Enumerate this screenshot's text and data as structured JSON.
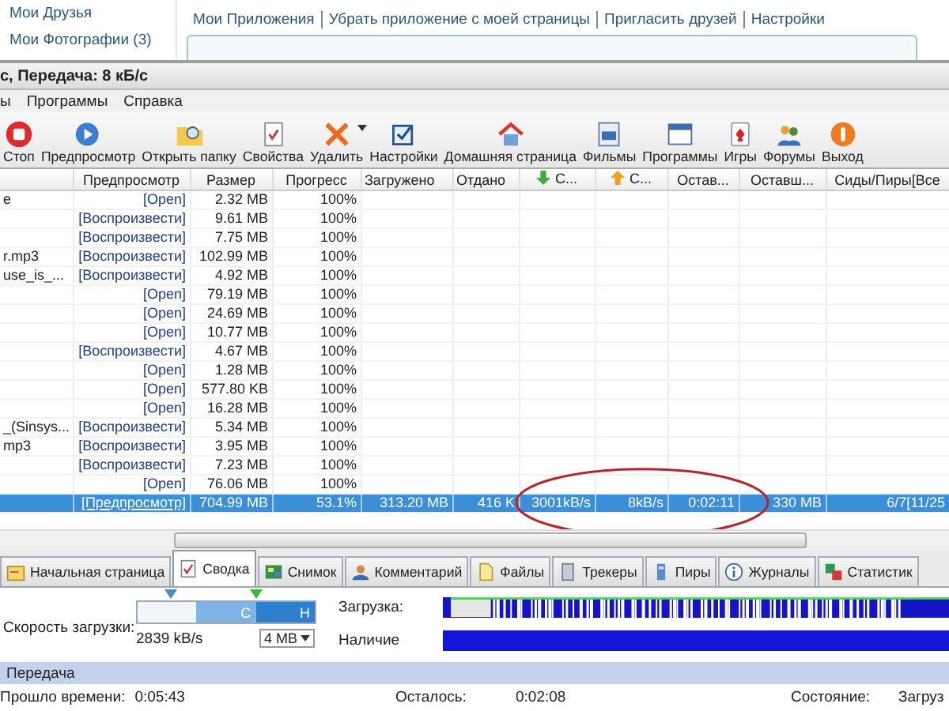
{
  "web_page": {
    "sidebar_links": [
      "Мои Друзья",
      "Мои Фотографии (3)"
    ],
    "nav_links": [
      "Мои Приложения",
      "Убрать приложение с моей страницы",
      "Пригласить друзей",
      "Настройки"
    ]
  },
  "window": {
    "title": "с, Передача: 8 кБ/с"
  },
  "menu": [
    "ы",
    "Программы",
    "Справка"
  ],
  "toolbar": [
    {
      "kind": "stop",
      "label": "Стоп"
    },
    {
      "kind": "preview",
      "label": "Предпросмотр"
    },
    {
      "kind": "folder",
      "label": "Открыть папку"
    },
    {
      "kind": "properties",
      "label": "Свойства"
    },
    {
      "kind": "delete",
      "label": "Удалить"
    },
    {
      "kind": "settings",
      "label": "Настройки"
    },
    {
      "kind": "home",
      "label": "Домашняя страница"
    },
    {
      "kind": "films",
      "label": "Фильмы"
    },
    {
      "kind": "programs",
      "label": "Программы"
    },
    {
      "kind": "games",
      "label": "Игры"
    },
    {
      "kind": "forums",
      "label": "Форумы"
    },
    {
      "kind": "exit",
      "label": "Выход"
    }
  ],
  "table": {
    "columns": [
      {
        "kind": "plain"
      },
      {
        "kind": "plain",
        "label": "Предпросмотр"
      },
      {
        "kind": "plain",
        "label": "Размер"
      },
      {
        "kind": "plain",
        "label": "Прогресс"
      },
      {
        "kind": "plain",
        "label": "Загружено"
      },
      {
        "kind": "plain",
        "label": "Отдано"
      },
      {
        "kind": "download",
        "label": "С..."
      },
      {
        "kind": "upload",
        "label": "С..."
      },
      {
        "kind": "plain",
        "label": "Остав..."
      },
      {
        "kind": "plain",
        "label": "Оставш..."
      },
      {
        "kind": "plain",
        "label": "Сиды/Пиры[Все"
      }
    ],
    "rows": [
      {
        "selected": false,
        "cells": [
          "e",
          "[Open]",
          "2.32 MB",
          "100%",
          null,
          null,
          null,
          null,
          null,
          null,
          null
        ]
      },
      {
        "selected": false,
        "cells": [
          null,
          "[Воспроизвести]",
          "9.61 MB",
          "100%",
          null,
          null,
          null,
          null,
          null,
          null,
          null
        ]
      },
      {
        "selected": false,
        "cells": [
          null,
          "[Воспроизвести]",
          "7.75 MB",
          "100%",
          null,
          null,
          null,
          null,
          null,
          null,
          null
        ]
      },
      {
        "selected": false,
        "cells": [
          "r.mp3",
          "[Воспроизвести]",
          "102.99 MB",
          "100%",
          null,
          null,
          null,
          null,
          null,
          null,
          null
        ]
      },
      {
        "selected": false,
        "cells": [
          "use_is_...",
          "[Воспроизвести]",
          "4.92 MB",
          "100%",
          null,
          null,
          null,
          null,
          null,
          null,
          null
        ]
      },
      {
        "selected": false,
        "cells": [
          null,
          "[Open]",
          "79.19 MB",
          "100%",
          null,
          null,
          null,
          null,
          null,
          null,
          null
        ]
      },
      {
        "selected": false,
        "cells": [
          null,
          "[Open]",
          "24.69 MB",
          "100%",
          null,
          null,
          null,
          null,
          null,
          null,
          null
        ]
      },
      {
        "selected": false,
        "cells": [
          null,
          "[Open]",
          "10.77 MB",
          "100%",
          null,
          null,
          null,
          null,
          null,
          null,
          null
        ]
      },
      {
        "selected": false,
        "cells": [
          null,
          "[Воспроизвести]",
          "4.67 MB",
          "100%",
          null,
          null,
          null,
          null,
          null,
          null,
          null
        ]
      },
      {
        "selected": false,
        "cells": [
          null,
          "[Open]",
          "1.28 MB",
          "100%",
          null,
          null,
          null,
          null,
          null,
          null,
          null
        ]
      },
      {
        "selected": false,
        "cells": [
          null,
          "[Open]",
          "577.80 KB",
          "100%",
          null,
          null,
          null,
          null,
          null,
          null,
          null
        ]
      },
      {
        "selected": false,
        "cells": [
          null,
          "[Open]",
          "16.28 MB",
          "100%",
          null,
          null,
          null,
          null,
          null,
          null,
          null
        ]
      },
      {
        "selected": false,
        "cells": [
          "_(Sinsys...",
          "[Воспроизвести]",
          "5.34 MB",
          "100%",
          null,
          null,
          null,
          null,
          null,
          null,
          null
        ]
      },
      {
        "selected": false,
        "cells": [
          "mp3",
          "[Воспроизвести]",
          "3.95 MB",
          "100%",
          null,
          null,
          null,
          null,
          null,
          null,
          null
        ]
      },
      {
        "selected": false,
        "cells": [
          null,
          "[Воспроизвести]",
          "7.23 MB",
          "100%",
          null,
          null,
          null,
          null,
          null,
          null,
          null
        ]
      },
      {
        "selected": false,
        "cells": [
          null,
          "[Open]",
          "76.06 MB",
          "100%",
          null,
          null,
          null,
          null,
          null,
          null,
          null
        ]
      },
      {
        "selected": true,
        "cells": [
          null,
          "[Предпросмотр]",
          "704.99 MB",
          "53.1%",
          "313.20 MB",
          "416 K",
          "3001kB/s",
          "8kB/s",
          "0:02:11",
          "330 MB",
          "6/7[11/25"
        ]
      }
    ]
  },
  "tabs": [
    {
      "kind": "home",
      "label": "Начальная страница",
      "selected": false
    },
    {
      "kind": "summary",
      "label": "Сводка",
      "selected": true
    },
    {
      "kind": "snapshot",
      "label": "Снимок",
      "selected": false
    },
    {
      "kind": "comment",
      "label": "Комментарий",
      "selected": false
    },
    {
      "kind": "files",
      "label": "Файлы",
      "selected": false
    },
    {
      "kind": "trackers",
      "label": "Трекеры",
      "selected": false
    },
    {
      "kind": "peers",
      "label": "Пиры",
      "selected": false
    },
    {
      "kind": "logs",
      "label": "Журналы",
      "selected": false
    },
    {
      "kind": "stats",
      "label": "Статистик",
      "selected": false
    }
  ],
  "summary": {
    "speed_label": "Скорость загрузки:",
    "speed_slider": {
      "labels": [
        "C",
        "H"
      ],
      "markers": [
        {
          "level": 0.19,
          "color": "#4a8ac8"
        },
        {
          "level": 0.67,
          "color": "#3cb83c"
        }
      ]
    },
    "speed_value": "2839 kB/s",
    "cache_dropdown": "4 MB",
    "download_label": "Загрузка:",
    "availability_label": "Наличие"
  },
  "transfer": {
    "title": "Передача",
    "fields": [
      {
        "label": "Прошло времени:",
        "value": "0:05:43"
      },
      {
        "label": "Осталось:",
        "value": "0:02:08"
      },
      {
        "label": "Состояние:",
        "value": "Загруз"
      }
    ]
  }
}
